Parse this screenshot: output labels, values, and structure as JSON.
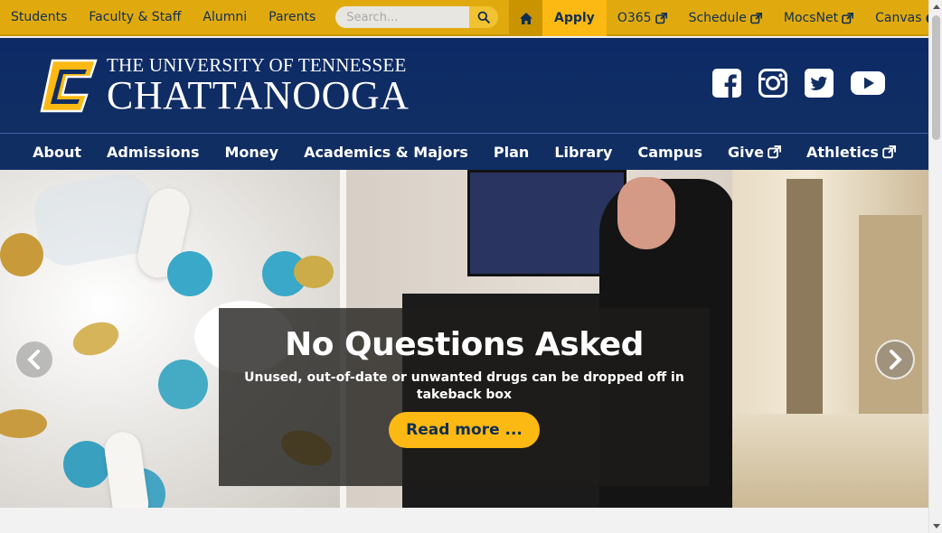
{
  "top_bar": {
    "audience_links": [
      "Students",
      "Faculty & Staff",
      "Alumni",
      "Parents"
    ],
    "search_placeholder": "Search...",
    "quick_links": {
      "apply": "Apply",
      "o365": "O365",
      "schedule": "Schedule",
      "mocsnet": "MocsNet",
      "canvas": "Canvas"
    }
  },
  "header": {
    "logo_line1": "THE UNIVERSITY OF TENNESSEE",
    "logo_line2": "CHATTANOOGA",
    "social_icons": [
      "facebook-icon",
      "instagram-icon",
      "twitter-icon",
      "youtube-icon"
    ]
  },
  "main_nav": {
    "items": [
      "About",
      "Admissions",
      "Money",
      "Academics & Majors",
      "Plan",
      "Library",
      "Campus",
      "Give",
      "Athletics"
    ]
  },
  "hero": {
    "title": "No Questions Asked",
    "subtitle": "Unused, out-of-date or unwanted drugs can be dropped off in takeback box",
    "button": "Read more ..."
  },
  "colors": {
    "gold": "#fdb913",
    "navy": "#112e63"
  }
}
